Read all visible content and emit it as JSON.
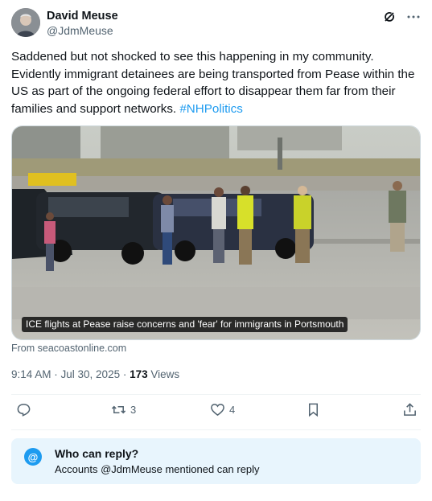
{
  "author": {
    "display_name": "David Meuse",
    "handle": "@JdmMeuse"
  },
  "header_icons": [
    "grok-icon",
    "more-icon"
  ],
  "tweet": {
    "text": "Saddened but not shocked to see this happening in my community. Evidently immigrant detainees are being transported from Pease within the US as part of the ongoing federal effort to disappear them far from their families and support networks. ",
    "hashtag": "#NHPolitics"
  },
  "media": {
    "caption": "ICE flights at Pease raise concerns and 'fear' for immigrants in Portsmouth",
    "source": "From seacoastonline.com"
  },
  "meta": {
    "time": "9:14 AM · Jul 30, 2025 · ",
    "views_count": "173",
    "views_label": " Views"
  },
  "actions": {
    "reply_count": "",
    "retweet_count": "3",
    "like_count": "4",
    "bookmark_count": "",
    "share_count": ""
  },
  "reply_settings": {
    "icon": "@",
    "title": "Who can reply?",
    "subtitle": "Accounts @JdmMeuse mentioned can reply"
  },
  "colors": {
    "accent": "#1d9bf0",
    "secondary_text": "#536471",
    "reply_box_bg": "#e8f5fd"
  }
}
